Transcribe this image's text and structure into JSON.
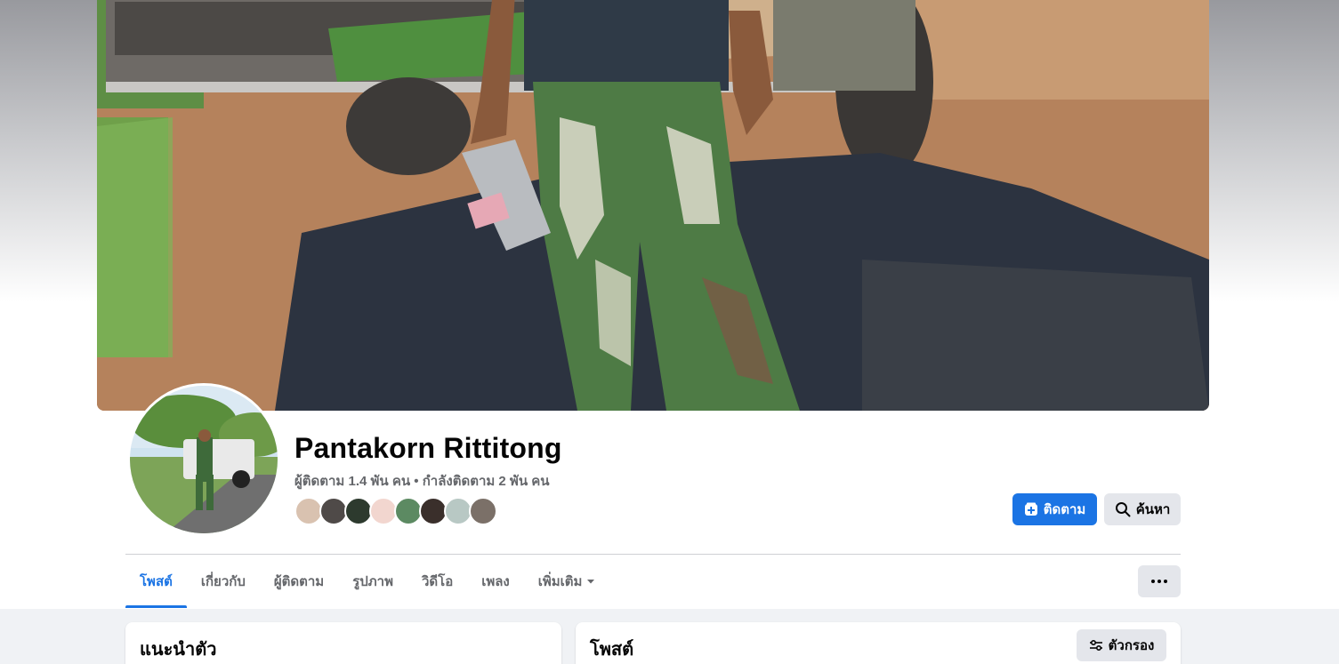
{
  "profile": {
    "name": "Pantakorn Rittitong",
    "follow_stats": "ผู้ติดตาม 1.4 พัน คน • กำลังติดตาม 2 พัน คน"
  },
  "actions": {
    "follow_label": "ติดตาม",
    "search_label": "ค้นหา"
  },
  "tabs": [
    {
      "label": "โพสต์",
      "active": true
    },
    {
      "label": "เกี่ยวกับ",
      "active": false
    },
    {
      "label": "ผู้ติดตาม",
      "active": false
    },
    {
      "label": "รูปภาพ",
      "active": false
    },
    {
      "label": "วิดีโอ",
      "active": false
    },
    {
      "label": "เพลง",
      "active": false
    },
    {
      "label": "เพิ่มเติม",
      "active": false
    }
  ],
  "intro_card": {
    "title": "แนะนำตัว"
  },
  "posts_card": {
    "title": "โพสต์",
    "filter_label": "ตัวกรอง"
  },
  "colors": {
    "accent": "#1b74e4",
    "secondary_button": "#e4e6eb",
    "muted_text": "#65676b"
  }
}
